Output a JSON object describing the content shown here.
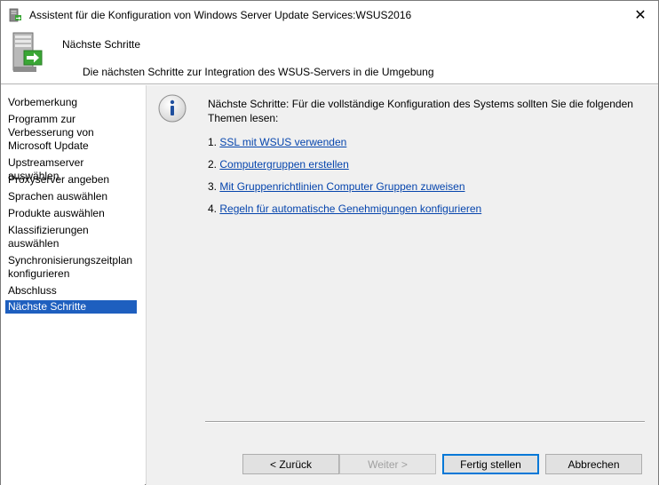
{
  "window": {
    "title": "Assistent für die Konfiguration von Windows Server Update Services:WSUS2016",
    "close_glyph": "✕"
  },
  "header": {
    "title": "Nächste Schritte",
    "subtitle": "Die nächsten Schritte zur Integration des WSUS-Servers in die Umgebung"
  },
  "sidebar": {
    "items": [
      {
        "label": "Vorbemerkung",
        "active": false
      },
      {
        "label": "Programm zur Verbesserung von Microsoft Update",
        "active": false
      },
      {
        "label": "Upstreamserver auswählen",
        "active": false
      },
      {
        "label": "Proxyserver angeben",
        "active": false
      },
      {
        "label": "Sprachen auswählen",
        "active": false
      },
      {
        "label": "Produkte auswählen",
        "active": false
      },
      {
        "label": "Klassifizierungen auswählen",
        "active": false
      },
      {
        "label": "Synchronisierungszeitplan konfigurieren",
        "active": false
      },
      {
        "label": "Abschluss",
        "active": false
      },
      {
        "label": "Nächste Schritte",
        "active": true
      }
    ]
  },
  "main": {
    "intro": "Nächste Schritte: Für die vollständige Konfiguration des Systems sollten Sie die folgenden Themen lesen:",
    "steps": [
      {
        "number": "1.",
        "link": "SSL mit WSUS verwenden"
      },
      {
        "number": "2.",
        "link": "Computergruppen erstellen"
      },
      {
        "number": "3.",
        "link": "Mit Gruppenrichtlinien Computer Gruppen zuweisen"
      },
      {
        "number": "4.",
        "link": "Regeln für automatische Genehmigungen konfigurieren"
      }
    ]
  },
  "buttons": {
    "back": "< Zurück",
    "next": "Weiter >",
    "finish": "Fertig stellen",
    "cancel": "Abbrechen"
  },
  "icons": {
    "title": "wsus-server-icon",
    "header": "server-arrow-icon",
    "info": "info-icon"
  },
  "colors": {
    "accent": "#0078d7",
    "selection": "#1e5fbf",
    "link": "#0645ad",
    "content_bg": "#f0f0f0"
  }
}
